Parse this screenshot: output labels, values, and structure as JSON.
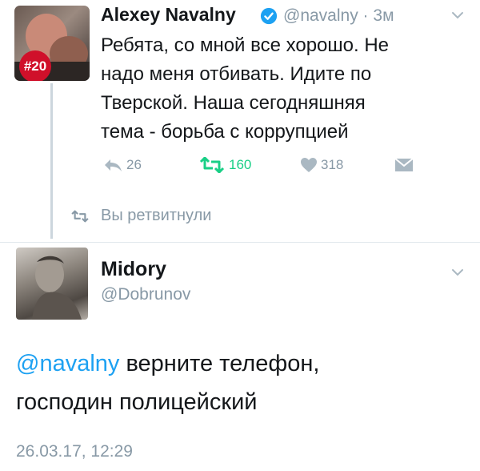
{
  "tweet": {
    "author_name": "Alexey Navalny",
    "handle": "@navalny",
    "separator": "·",
    "time": "3м",
    "avatar_badge": "#20",
    "text": "Ребята, со мной все хорошо. Не\nнадо меня отбивать. Идите по\nТверской. Наша сегодняшняя\nтема - борьба с коррупцией",
    "reply_count": "26",
    "retweet_count": "160",
    "like_count": "318",
    "retweet_note": "Вы ретвитнули"
  },
  "reply": {
    "name": "Midory",
    "handle": "@Dobrunov",
    "mention": "@navalny",
    "text_after_mention": " верните телефон,",
    "text_line2": "господин полицейский",
    "datetime": "26.03.17, 12:29"
  },
  "colors": {
    "link": "#1da1f2",
    "muted": "#8899a6",
    "retweet_green": "#19cf86",
    "badge_red": "#d0102a"
  },
  "icons": [
    "verified-icon",
    "chevron-down-icon",
    "reply-icon",
    "retweet-icon",
    "heart-icon",
    "direct-message-icon"
  ]
}
